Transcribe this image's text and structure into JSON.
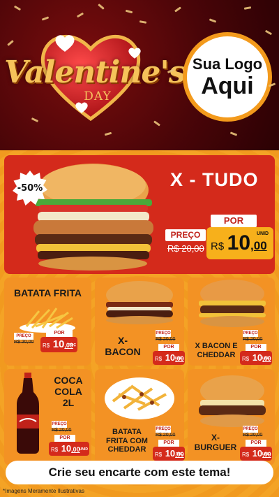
{
  "header": {
    "title_main": "Valentine's",
    "title_sub": "DAY",
    "logo_line1": "Sua Logo",
    "logo_line2": "Aqui"
  },
  "hero": {
    "discount": "-50%",
    "name": "X - TUDO",
    "preco_label": "PREÇO",
    "old_price": "R$ 20,00",
    "por_label": "POR",
    "currency": "R$",
    "price_int": "10",
    "price_cents": ",00",
    "unit": "UNID"
  },
  "products": [
    {
      "name": "BATATA FRITA",
      "preco_label": "PREÇO",
      "old_price": "R$ 20,00",
      "por_label": "POR",
      "currency": "R$",
      "price_int": "10",
      "price_cents": ",00",
      "unit": "POÇ"
    },
    {
      "name": "X-\nBACON",
      "preco_label": "PREÇO",
      "old_price": "R$ 20,00",
      "por_label": "POR",
      "currency": "R$",
      "price_int": "10",
      "price_cents": ",00",
      "unit": "UNID"
    },
    {
      "name": "X BACON E\nCHEDDAR",
      "preco_label": "PREÇO",
      "old_price": "R$ 20,00",
      "por_label": "POR",
      "currency": "R$",
      "price_int": "10",
      "price_cents": ",00",
      "unit": "UNID"
    },
    {
      "name": "COCA\nCOLA\n2L",
      "preco_label": "PREÇO",
      "old_price": "R$ 20,00",
      "por_label": "POR",
      "currency": "R$",
      "price_int": "10",
      "price_cents": ",00",
      "unit": "UNID"
    },
    {
      "name": "BATATA\nFRITA COM\nCHEDDAR",
      "preco_label": "PREÇO",
      "old_price": "R$ 20,00",
      "por_label": "POR",
      "currency": "R$",
      "price_int": "10",
      "price_cents": ",00",
      "unit": "POÇ"
    },
    {
      "name": "X-\nBURGUER",
      "preco_label": "PREÇO",
      "old_price": "R$ 20,00",
      "por_label": "POR",
      "currency": "R$",
      "price_int": "10",
      "price_cents": ",00",
      "unit": "UNID"
    }
  ],
  "cta": "Crie seu encarte com este tema!",
  "disclaimer": "*Imagens Meramente Ilustrativas",
  "colors": {
    "header_bg": "#4a0508",
    "hero_bg": "#d42a1b",
    "card_bg": "#f39224",
    "accent_gold": "#f6c35a",
    "logo_ring": "#f39a1c"
  }
}
